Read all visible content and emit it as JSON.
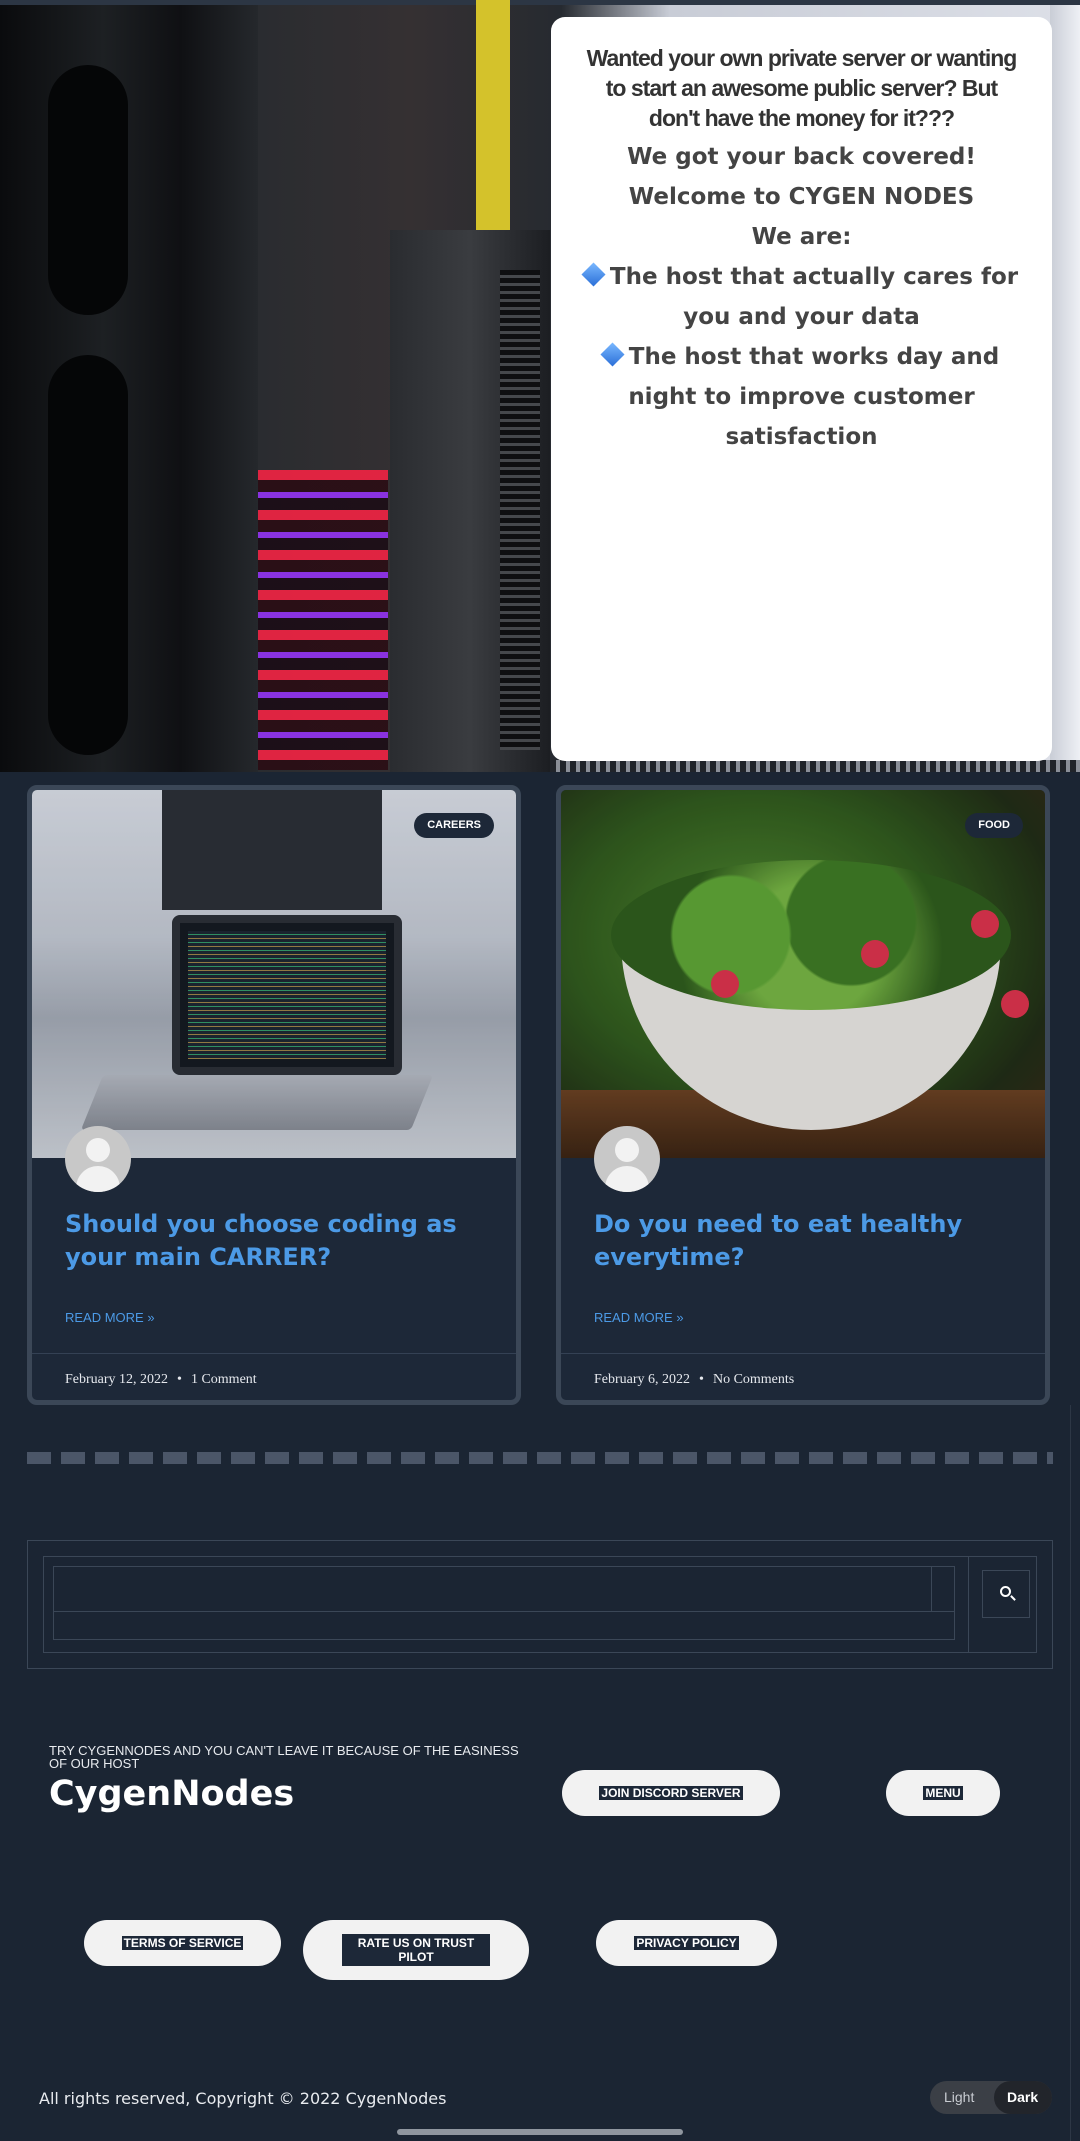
{
  "hero": {
    "lead": "Wanted your own private server or wanting to start an awesome public server? But don't have the money for it???",
    "line1": "We got your back covered!",
    "line2": "Welcome to CYGEN NODES",
    "line3": "We are:",
    "bullet1": "The host that actually cares for you and your data",
    "bullet2": "The host that works day and night to improve customer satisfaction"
  },
  "posts": [
    {
      "badge": "CAREERS",
      "title": "Should you choose coding as your main CARRER?",
      "read_more": "READ MORE »",
      "date": "February 12, 2022",
      "comments": "1 Comment",
      "thumb_icon": "laptop-code-image"
    },
    {
      "badge": "FOOD",
      "title": "Do you need to eat healthy everytime?",
      "read_more": "READ MORE »",
      "date": "February 6, 2022",
      "comments": "No Comments",
      "thumb_icon": "salad-bowl-image"
    }
  ],
  "meta_separator": "•",
  "search": {
    "placeholder": "",
    "button_icon": "search-icon"
  },
  "footer": {
    "tagline": "TRY CYGENNODES AND YOU CAN'T LEAVE IT BECAUSE OF THE EASINESS OF OUR HOST",
    "brand": "CygenNodes",
    "join_discord": "JOIN DISCORD SERVER",
    "menu": "MENU",
    "terms": "TERMS OF SERVICE",
    "rate_us": "RATE US ON TRUST PILOT",
    "privacy": "PRIVACY POLICY",
    "copyright": "All rights reserved, Copyright © 2022 CygenNodes"
  },
  "theme_toggle": {
    "light": "Light",
    "dark": "Dark",
    "selected": "Dark"
  },
  "colors": {
    "background": "#1b2533",
    "card_border": "#3b4757",
    "accent_link": "#4c9ae6",
    "pill": "#f2f2f2"
  }
}
